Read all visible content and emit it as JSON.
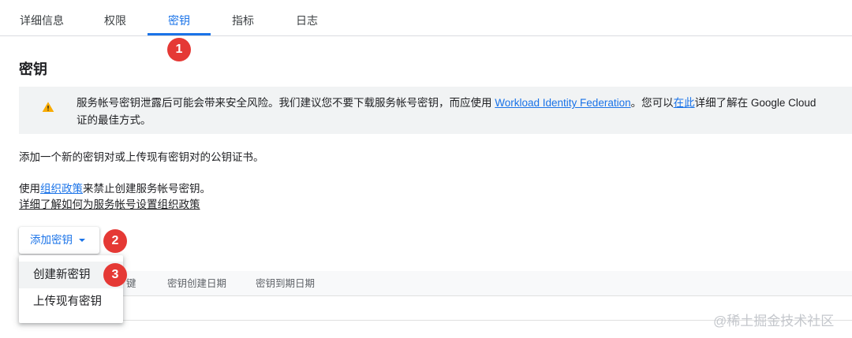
{
  "tabs": [
    {
      "label": "详细信息"
    },
    {
      "label": "权限"
    },
    {
      "label": "密钥"
    },
    {
      "label": "指标"
    },
    {
      "label": "日志"
    }
  ],
  "active_tab": "密钥",
  "section_title": "密钥",
  "banner": {
    "text_1": "服务帐号密钥泄露后可能会带来安全风险。我们建议您不要下载服务帐号密钥，而应使用 ",
    "link_1": "Workload Identity Federation",
    "text_2": "。您可以",
    "link_2": "在此",
    "text_3": "详细了解在 Google Cloud",
    "text_4": "证的最佳方式。",
    "icon": "warning-icon"
  },
  "description": "添加一个新的密钥对或上传现有密钥对的公钥证书。",
  "policy": {
    "prefix": "使用",
    "link": "组织政策",
    "suffix": "来禁止创建服务帐号密钥。",
    "learn_more": "详细了解如何为服务帐号设置组织政策"
  },
  "add_key_button": "添加密钥",
  "menu": {
    "items": [
      {
        "label": "创建新密钥"
      },
      {
        "label": "上传现有密钥"
      }
    ]
  },
  "table": {
    "headers": [
      "键",
      "密钥创建日期",
      "密钥到期日期"
    ]
  },
  "callouts": [
    "1",
    "2",
    "3"
  ],
  "watermark": "@稀土掘金技术社区",
  "colors": {
    "accent": "#1a73e8",
    "callout": "#e53935",
    "warning": "#f9ab00"
  }
}
